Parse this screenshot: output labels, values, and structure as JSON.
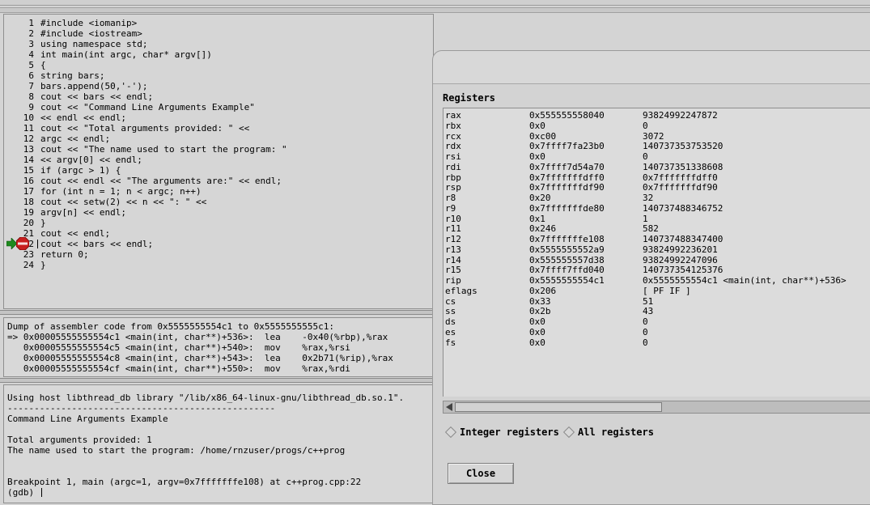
{
  "source": {
    "lines": [
      {
        "num": "1",
        "code": "#include <iomanip>"
      },
      {
        "num": "2",
        "code": "#include <iostream>"
      },
      {
        "num": "3",
        "code": "using namespace std;"
      },
      {
        "num": "4",
        "code": "int main(int argc, char* argv[])"
      },
      {
        "num": "5",
        "code": "{"
      },
      {
        "num": "6",
        "code": "string bars;"
      },
      {
        "num": "7",
        "code": "bars.append(50,'-');"
      },
      {
        "num": "8",
        "code": "cout << bars << endl;"
      },
      {
        "num": "9",
        "code": "cout << \"Command Line Arguments Example\""
      },
      {
        "num": "10",
        "code": "<< endl << endl;"
      },
      {
        "num": "11",
        "code": "cout << \"Total arguments provided: \" <<"
      },
      {
        "num": "12",
        "code": "argc << endl;"
      },
      {
        "num": "13",
        "code": "cout << \"The name used to start the program: \""
      },
      {
        "num": "14",
        "code": "<< argv[0] << endl;"
      },
      {
        "num": "15",
        "code": "if (argc > 1) {"
      },
      {
        "num": "16",
        "code": "cout << endl << \"The arguments are:\" << endl;"
      },
      {
        "num": "17",
        "code": "for (int n = 1; n < argc; n++)"
      },
      {
        "num": "18",
        "code": "cout << setw(2) << n << \": \" <<"
      },
      {
        "num": "19",
        "code": "argv[n] << endl;"
      },
      {
        "num": "20",
        "code": "}"
      },
      {
        "num": "21",
        "code": "cout << endl;"
      },
      {
        "num": "2",
        "code": "cout << bars << endl;"
      },
      {
        "num": "23",
        "code": "return 0;"
      },
      {
        "num": "24",
        "code": "}"
      }
    ],
    "breakpoint_line": "22",
    "breakpoint_icon": "stop-sign-icon",
    "current_arrow_icon": "green-arrow-icon",
    "colors": {
      "arrow": "#1e8a1e",
      "stop": "#c81e1e"
    }
  },
  "assembler": {
    "header": "Dump of assembler code from 0x5555555554c1 to 0x5555555555c1:",
    "lines": [
      "=> 0x00005555555554c1 <main(int, char**)+536>:  lea    -0x40(%rbp),%rax",
      "   0x00005555555554c5 <main(int, char**)+540>:  mov    %rax,%rsi",
      "   0x00005555555554c8 <main(int, char**)+543>:  lea    0x2b71(%rip),%rax",
      "   0x00005555555554cf <main(int, char**)+550>:  mov    %rax,%rdi"
    ]
  },
  "console": {
    "lines": [
      "Using host libthread_db library \"/lib/x86_64-linux-gnu/libthread_db.so.1\".",
      "--------------------------------------------------",
      "Command Line Arguments Example",
      "",
      "Total arguments provided: 1",
      "The name used to start the program: /home/rnzuser/progs/c++prog",
      "",
      "",
      "Breakpoint 1, main (argc=1, argv=0x7fffffffe108) at c++prog.cpp:22"
    ],
    "prompt": "(gdb) "
  },
  "registers": {
    "title": "Registers",
    "rows": [
      {
        "name": "rax",
        "hex": "0x555555558040",
        "value": "93824992247872"
      },
      {
        "name": "rbx",
        "hex": "0x0",
        "value": "0"
      },
      {
        "name": "rcx",
        "hex": "0xc00",
        "value": "3072"
      },
      {
        "name": "rdx",
        "hex": "0x7ffff7fa23b0",
        "value": "140737353753520"
      },
      {
        "name": "rsi",
        "hex": "0x0",
        "value": "0"
      },
      {
        "name": "rdi",
        "hex": "0x7ffff7d54a70",
        "value": "140737351338608"
      },
      {
        "name": "rbp",
        "hex": "0x7fffffffdff0",
        "value": "0x7fffffffdff0"
      },
      {
        "name": "rsp",
        "hex": "0x7fffffffdf90",
        "value": "0x7fffffffdf90"
      },
      {
        "name": "r8",
        "hex": "0x20",
        "value": "32"
      },
      {
        "name": "r9",
        "hex": "0x7fffffffde80",
        "value": "140737488346752"
      },
      {
        "name": "r10",
        "hex": "0x1",
        "value": "1"
      },
      {
        "name": "r11",
        "hex": "0x246",
        "value": "582"
      },
      {
        "name": "r12",
        "hex": "0x7fffffffe108",
        "value": "140737488347400"
      },
      {
        "name": "r13",
        "hex": "0x5555555552a9",
        "value": "93824992236201"
      },
      {
        "name": "r14",
        "hex": "0x555555557d38",
        "value": "93824992247096"
      },
      {
        "name": "r15",
        "hex": "0x7ffff7ffd040",
        "value": "140737354125376"
      },
      {
        "name": "rip",
        "hex": "0x5555555554c1",
        "value": "0x5555555554c1 <main(int, char**)+536>"
      },
      {
        "name": "eflags",
        "hex": "0x206",
        "value": "[ PF IF ]"
      },
      {
        "name": "cs",
        "hex": "0x33",
        "value": "51"
      },
      {
        "name": "ss",
        "hex": "0x2b",
        "value": "43"
      },
      {
        "name": "ds",
        "hex": "0x0",
        "value": "0"
      },
      {
        "name": "es",
        "hex": "0x0",
        "value": "0"
      },
      {
        "name": "fs",
        "hex": "0x0",
        "value": "0"
      }
    ],
    "radio_integer": "Integer registers",
    "radio_all": "All registers",
    "close_label": "Close"
  }
}
